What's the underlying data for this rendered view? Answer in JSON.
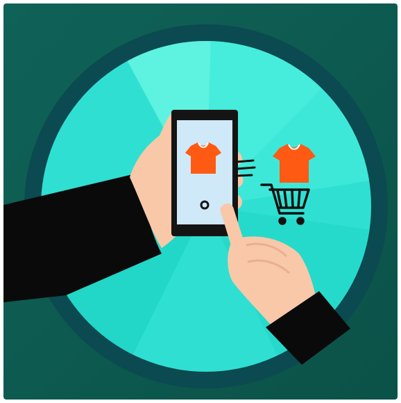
{
  "illustration": {
    "subject": "mobile-shopping",
    "colors": {
      "background": "#0e5a52",
      "ring": "#0a4a50",
      "disc_light": "#5ef2e0",
      "disc_mid": "#2fe0d2",
      "disc_dark": "#20d2c4",
      "sleeve": "#0a0a0a",
      "skin": "#f8c8a8",
      "skin_shadow": "#e8b090",
      "phone_body": "#141414",
      "phone_screen": "#cfe9f8",
      "shirt": "#ff5a14",
      "cart": "#111111"
    },
    "icons": [
      "t-shirt-on-screen-icon",
      "t-shirt-icon",
      "shopping-cart-icon",
      "swipe-lines-icon",
      "home-button-icon"
    ]
  }
}
